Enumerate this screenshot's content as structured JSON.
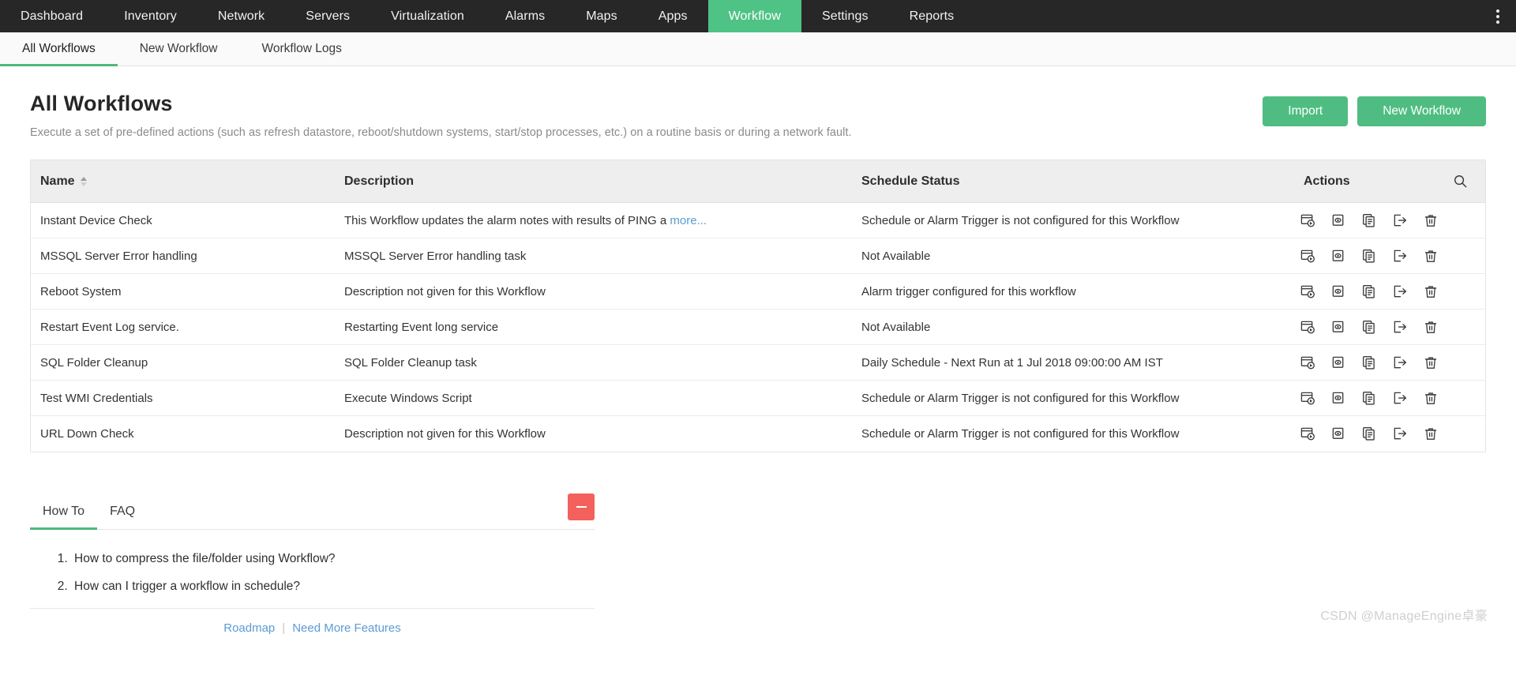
{
  "topnav": {
    "items": [
      {
        "label": "Dashboard",
        "active": false
      },
      {
        "label": "Inventory",
        "active": false
      },
      {
        "label": "Network",
        "active": false
      },
      {
        "label": "Servers",
        "active": false
      },
      {
        "label": "Virtualization",
        "active": false
      },
      {
        "label": "Alarms",
        "active": false
      },
      {
        "label": "Maps",
        "active": false
      },
      {
        "label": "Apps",
        "active": false
      },
      {
        "label": "Workflow",
        "active": true
      },
      {
        "label": "Settings",
        "active": false
      },
      {
        "label": "Reports",
        "active": false
      }
    ],
    "kebab_icon": "more-vertical-icon",
    "active_color": "#4fc285",
    "bar_color": "#272727"
  },
  "subnav": {
    "items": [
      {
        "label": "All Workflows",
        "active": true
      },
      {
        "label": "New Workflow",
        "active": false
      },
      {
        "label": "Workflow Logs",
        "active": false
      }
    ],
    "underline_color": "#4fb87d"
  },
  "header": {
    "title": "All Workflows",
    "subtitle": "Execute a set of pre-defined actions (such as refresh datastore, reboot/shutdown systems, start/stop processes, etc.) on a routine basis or during a network fault.",
    "import_label": "Import",
    "new_workflow_label": "New Workflow",
    "button_color": "#4fbd81"
  },
  "table": {
    "columns": [
      "Name",
      "Description",
      "Schedule Status",
      "Actions"
    ],
    "sort_column": "Name",
    "sort_direction": "asc",
    "search_icon": "search-icon",
    "action_icons": [
      "execute-workflow-icon",
      "view-workflow-icon",
      "copy-workflow-icon",
      "export-workflow-icon",
      "delete-workflow-icon"
    ],
    "rows": [
      {
        "name": "Instant Device Check",
        "description": "This Workflow updates the alarm notes with results of PING a ",
        "more_label": "more...",
        "status": "Schedule or Alarm Trigger is not configured for this Workflow"
      },
      {
        "name": "MSSQL Server Error handling",
        "description": "MSSQL Server Error handling task",
        "more_label": "",
        "status": "Not Available"
      },
      {
        "name": "Reboot System",
        "description": "Description not given for this Workflow",
        "more_label": "",
        "status": "Alarm trigger configured for this workflow"
      },
      {
        "name": "Restart Event Log service.",
        "description": "Restarting Event long service",
        "more_label": "",
        "status": "Not Available"
      },
      {
        "name": "SQL Folder Cleanup",
        "description": "SQL Folder Cleanup task",
        "more_label": "",
        "status": "Daily Schedule - Next Run at 1 Jul 2018 09:00:00 AM IST"
      },
      {
        "name": "Test WMI Credentials",
        "description": "Execute Windows Script",
        "more_label": "",
        "status": "Schedule or Alarm Trigger is not configured for this Workflow"
      },
      {
        "name": "URL Down Check",
        "description": "Description not given for this Workflow",
        "more_label": "",
        "status": "Schedule or Alarm Trigger is not configured for this Workflow"
      }
    ]
  },
  "help": {
    "tabs": [
      {
        "label": "How To",
        "active": true
      },
      {
        "label": "FAQ",
        "active": false
      }
    ],
    "collapse_icon": "minus-icon",
    "collapse_color": "#f4605c",
    "items": [
      "How to compress the file/folder using Workflow?",
      "How can I trigger a workflow in schedule?"
    ],
    "footer": {
      "roadmap_label": "Roadmap",
      "separator": "|",
      "more_features_label": "Need More Features"
    }
  },
  "watermark": "CSDN @ManageEngine卓豪"
}
